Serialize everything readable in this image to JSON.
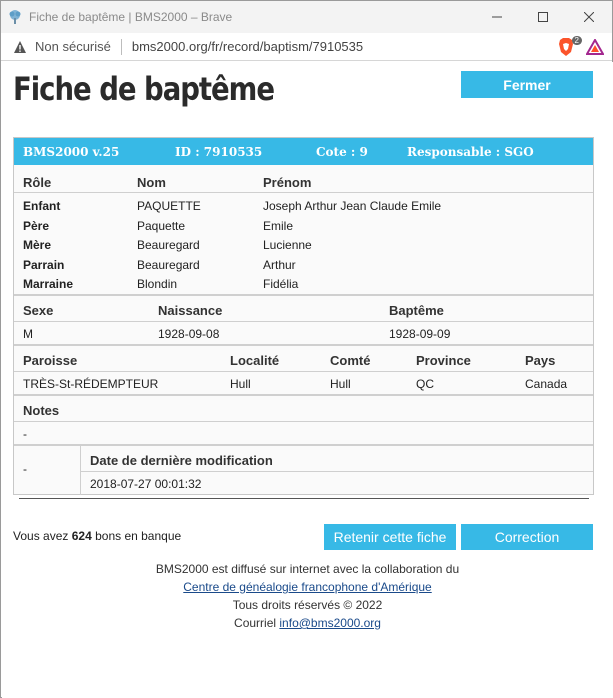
{
  "window": {
    "title": "Fiche de baptême | BMS2000 – Brave"
  },
  "address": {
    "security_label": "Non sécurisé",
    "url": "bms2000.org/fr/record/baptism/7910535",
    "brave_badge": "2"
  },
  "page": {
    "title": "Fiche de baptême",
    "close_label": "Fermer"
  },
  "record": {
    "header": {
      "version": "BMS2000 v.25",
      "id": "ID : 7910535",
      "cote": "Cote : 9",
      "responsable": "Responsable : SGO"
    },
    "people_headers": [
      "Rôle",
      "Nom",
      "Prénom"
    ],
    "people": [
      {
        "role": "Enfant",
        "nom": "PAQUETTE",
        "prenom": "Joseph Arthur Jean Claude Emile"
      },
      {
        "role": "Père",
        "nom": "Paquette",
        "prenom": "Emile"
      },
      {
        "role": "Mère",
        "nom": "Beauregard",
        "prenom": "Lucienne"
      },
      {
        "role": "Parrain",
        "nom": "Beauregard",
        "prenom": "Arthur"
      },
      {
        "role": "Marraine",
        "nom": "Blondin",
        "prenom": "Fidélia"
      }
    ],
    "birth_headers": [
      "Sexe",
      "Naissance",
      "Baptême"
    ],
    "birth": {
      "sexe": "M",
      "naissance": "1928-09-08",
      "bapteme": "1928-09-09"
    },
    "place_headers": [
      "Paroisse",
      "Localité",
      "Comté",
      "Province",
      "Pays"
    ],
    "place": {
      "paroisse": "TRÈS-St-RÉDEMPTEUR",
      "localite": "Hull",
      "comte": "Hull",
      "province": "QC",
      "pays": "Canada"
    },
    "notes_header": "Notes",
    "notes": "-",
    "mod_left": "-",
    "mod_header": "Date de dernière modification",
    "mod_date": "2018-07-27 00:01:32"
  },
  "actions": {
    "bank_prefix": "Vous avez",
    "bank_count": "624",
    "bank_suffix": "bons en banque",
    "keep_label": "Retenir cette fiche",
    "correction_label": "Correction"
  },
  "footer": {
    "line1": "BMS2000 est diffusé sur internet avec la collaboration du",
    "link1": "Centre de généalogie francophone d'Amérique",
    "line3": "Tous droits réservés © 2022",
    "line4_prefix": "Courriel",
    "email": "info@bms2000.org"
  },
  "colors": {
    "accent": "#37b9e6",
    "brave": "#fb542b"
  }
}
